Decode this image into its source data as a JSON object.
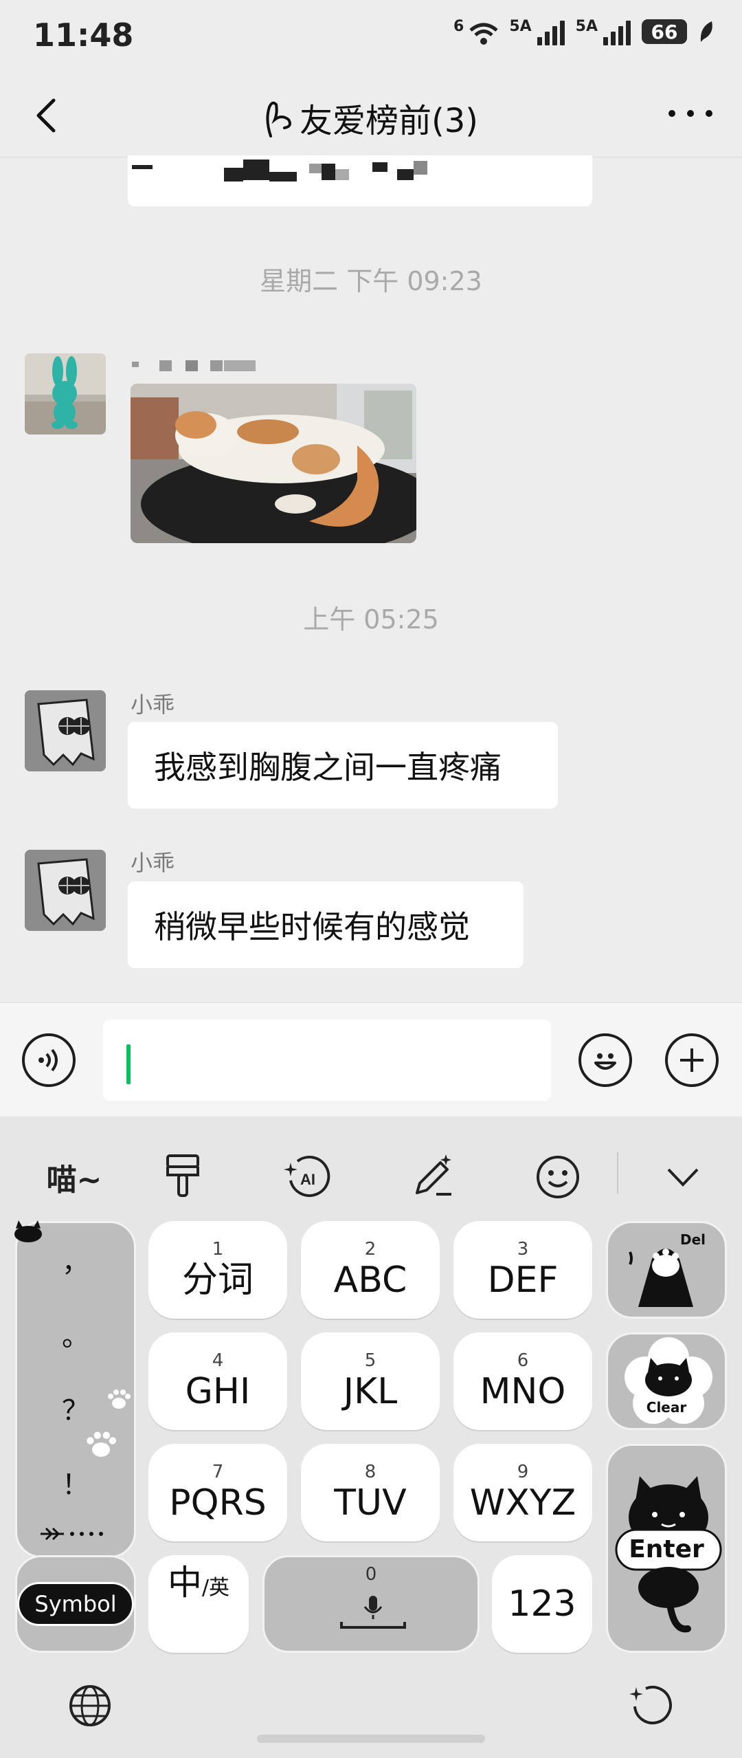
{
  "status": {
    "time": "11:48",
    "battery": "66",
    "signal_labels": [
      "6",
      "5A",
      "5A"
    ]
  },
  "header": {
    "title": "友爱榜前(3)"
  },
  "chat": {
    "timestamps": [
      "星期二 下午 09:23",
      "上午 05:25"
    ],
    "messages": [
      {
        "sender": "小乖",
        "text": "我感到胸腹之间一直疼痛"
      },
      {
        "sender": "小乖",
        "text": "稍微早些时候有的感觉"
      }
    ]
  },
  "keyboard": {
    "toolbar": {
      "meow": "喵~"
    },
    "keys": [
      {
        "num": "1",
        "label": "分词"
      },
      {
        "num": "2",
        "label": "ABC"
      },
      {
        "num": "3",
        "label": "DEF"
      },
      {
        "num": "4",
        "label": "GHI"
      },
      {
        "num": "5",
        "label": "JKL"
      },
      {
        "num": "6",
        "label": "MNO"
      },
      {
        "num": "7",
        "label": "PQRS"
      },
      {
        "num": "8",
        "label": "TUV"
      },
      {
        "num": "9",
        "label": "WXYZ"
      }
    ],
    "punctuation": [
      "，",
      "。",
      "？",
      "！"
    ],
    "del_label": "Del",
    "clear_label": "Clear",
    "enter_label": "Enter",
    "symbol_label": "Symbol",
    "lang_main": "中",
    "lang_sub": "/英",
    "space_num": "0",
    "num_label": "123"
  },
  "colors": {
    "accent": "#07c160",
    "background": "#ededed"
  }
}
